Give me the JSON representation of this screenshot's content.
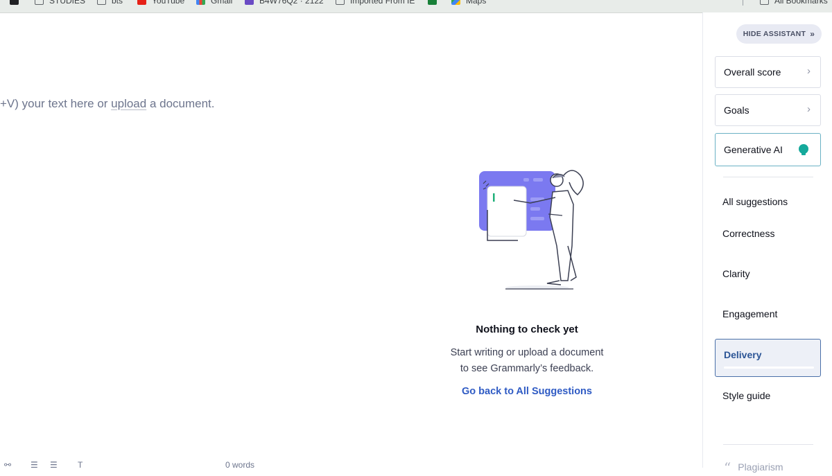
{
  "bookmarks_bar": {
    "items": [
      {
        "label": "",
        "icon": "theme-circle-icon"
      },
      {
        "label": "STUDIES",
        "icon": "folder-icon"
      },
      {
        "label": "bts",
        "icon": "folder-icon"
      },
      {
        "label": "YouTube",
        "icon": "youtube-icon"
      },
      {
        "label": "Gmail",
        "icon": "gmail-icon"
      },
      {
        "label": "B4W76Q2 · 2122",
        "icon": "classroom-icon"
      },
      {
        "label": "Imported From IE",
        "icon": "folder-icon"
      },
      {
        "label": "",
        "icon": "sheets-icon"
      },
      {
        "label": "Maps",
        "icon": "maps-icon"
      }
    ],
    "all_bookmarks": "All Bookmarks"
  },
  "editor": {
    "placeholder_prefix": "+V) your text here or ",
    "placeholder_link": "upload",
    "placeholder_suffix": " a document.",
    "word_count": "0 words"
  },
  "empty_state": {
    "title": "Nothing to check yet",
    "description_line1": "Start writing or upload a document",
    "description_line2": "to see Grammarly’s feedback.",
    "link": "Go back to All Suggestions"
  },
  "sidebar": {
    "hide_button": "HIDE ASSISTANT",
    "cards": {
      "overall_score": "Overall score",
      "goals": "Goals",
      "generative_ai": "Generative AI"
    },
    "nav": {
      "all_suggestions": "All suggestions",
      "correctness": "Correctness",
      "clarity": "Clarity",
      "engagement": "Engagement",
      "delivery": "Delivery",
      "style_guide": "Style guide",
      "plagiarism": "Plagiarism"
    },
    "selected": "Delivery"
  },
  "colors": {
    "accent_blue": "#2f5bc4",
    "selected_border": "#4a6fa8",
    "genai_green": "#15a99b",
    "illustration_purple": "#7b79f0"
  }
}
